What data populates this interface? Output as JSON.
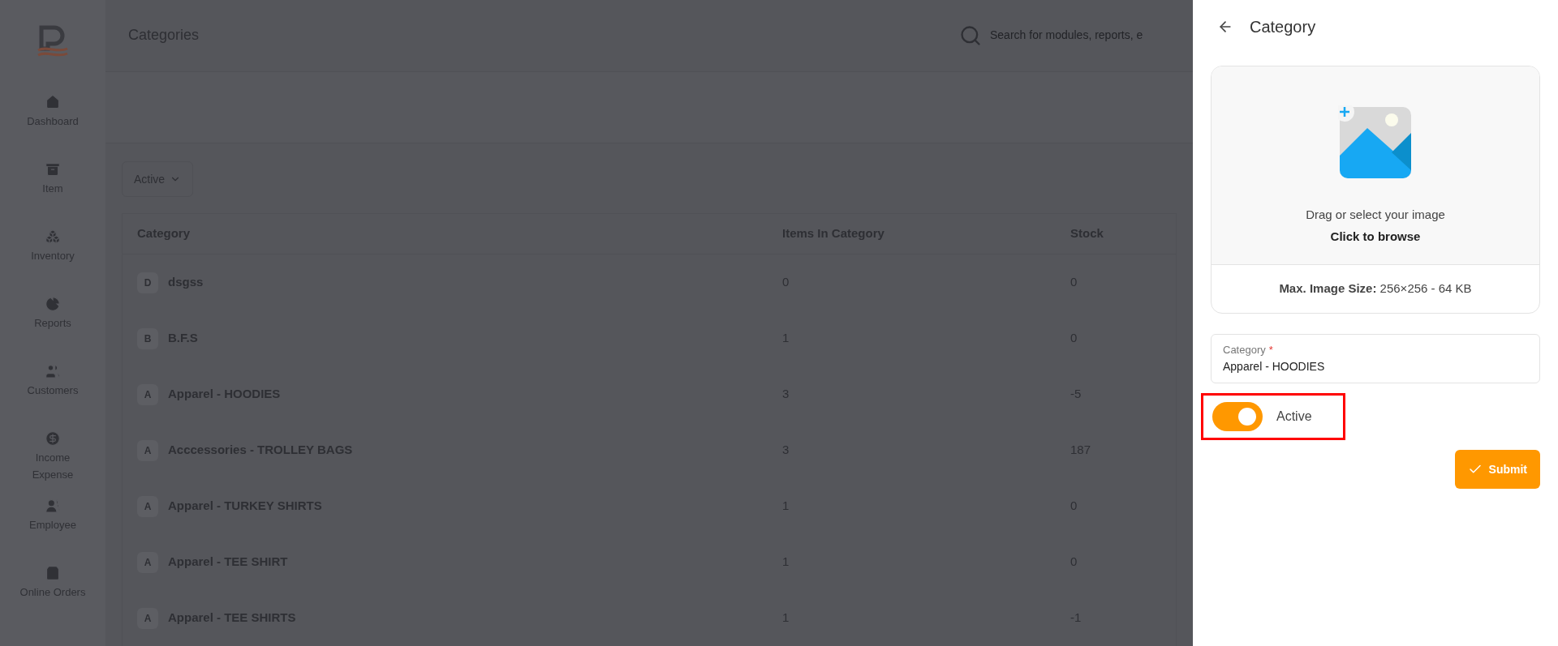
{
  "sidebar": {
    "items": [
      {
        "label": "Dashboard"
      },
      {
        "label": "Item"
      },
      {
        "label": "Inventory"
      },
      {
        "label": "Reports"
      },
      {
        "label": "Customers"
      },
      {
        "label": "Income Expense"
      },
      {
        "label": "Employee"
      },
      {
        "label": "Online Orders"
      }
    ]
  },
  "header": {
    "title": "Categories",
    "search": {
      "placeholder": "Search for modules, reports, e"
    }
  },
  "filter": {
    "label": "Active"
  },
  "table": {
    "columns": [
      "Category",
      "Items In Category",
      "Stock"
    ],
    "rows": [
      {
        "initial": "D",
        "name": "dsgss",
        "items": "0",
        "stock": "0"
      },
      {
        "initial": "B",
        "name": "B.F.S",
        "items": "1",
        "stock": "0"
      },
      {
        "initial": "A",
        "name": "Apparel - HOODIES",
        "items": "3",
        "stock": "-5"
      },
      {
        "initial": "A",
        "name": "Acccessories - TROLLEY BAGS",
        "items": "3",
        "stock": "187"
      },
      {
        "initial": "A",
        "name": "Apparel - TURKEY SHIRTS",
        "items": "1",
        "stock": "0"
      },
      {
        "initial": "A",
        "name": "Apparel - TEE SHIRT",
        "items": "1",
        "stock": "0"
      },
      {
        "initial": "A",
        "name": "Apparel - TEE SHIRTS",
        "items": "1",
        "stock": "-1"
      }
    ]
  },
  "drawer": {
    "title": "Category",
    "upload": {
      "prompt": "Drag or select your image",
      "action": "Click to browse",
      "limit": "**Max. Image Size:** 256×256 - 64 KB"
    },
    "field": {
      "label": "Category",
      "required_mark": "*",
      "value": "Apparel - HOODIES"
    },
    "toggle": {
      "label": "Active",
      "on": true,
      "highlighted": true
    },
    "submit": "Submit"
  }
}
